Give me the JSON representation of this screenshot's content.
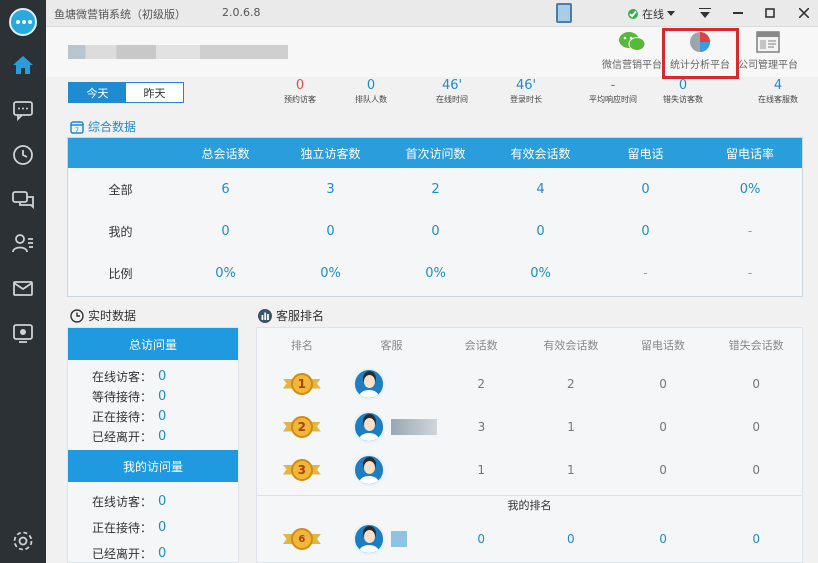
{
  "app": {
    "title": "鱼塘微营销系统（初级版）",
    "version": "2.0.6.8",
    "status": "在线"
  },
  "tools": [
    {
      "label": "微信营销平台",
      "icon": "wechat-icon"
    },
    {
      "label": "统计分析平台",
      "icon": "pie-chart-icon"
    },
    {
      "label": "公司管理平台",
      "icon": "window-icon"
    }
  ],
  "tabs": [
    "今天",
    "昨天"
  ],
  "stats": [
    {
      "value": "0",
      "label": "预约访客",
      "color": "#e05050"
    },
    {
      "value": "0",
      "label": "排队人数",
      "color": "#1f8bd1"
    },
    {
      "value": "46'",
      "label": "在线时间",
      "color": "#1f8bd1"
    },
    {
      "value": "46'",
      "label": "登录时长",
      "color": "#1f8bd1"
    },
    {
      "value": "-",
      "label": "平均响应时间",
      "color": "#1f8bd1"
    },
    {
      "value": "0",
      "label": "错失访客数",
      "color": "#1f8bd1"
    },
    {
      "value": "4",
      "label": "在线客服数",
      "color": "#1f8bd1"
    }
  ],
  "combined": {
    "title": "综合数据",
    "headers": [
      "",
      "总会话数",
      "独立访客数",
      "首次访问数",
      "有效会话数",
      "留电话",
      "留电话率"
    ],
    "rows": [
      {
        "label": "全部",
        "values": [
          "6",
          "3",
          "2",
          "4",
          "0",
          "0%"
        ]
      },
      {
        "label": "我的",
        "values": [
          "0",
          "0",
          "0",
          "0",
          "0",
          "-"
        ]
      },
      {
        "label": "比例",
        "values": [
          "0%",
          "0%",
          "0%",
          "0%",
          "-",
          "-"
        ]
      }
    ]
  },
  "realtime": {
    "title": "实时数据",
    "total_title": "总访问量",
    "total_lines": [
      {
        "label": "在线访客：",
        "value": "0"
      },
      {
        "label": "等待接待：",
        "value": "0"
      },
      {
        "label": "正在接待：",
        "value": "0"
      },
      {
        "label": "已经离开：",
        "value": "0"
      }
    ],
    "mine_title": "我的访问量",
    "mine_lines": [
      {
        "label": "在线访客：",
        "value": "0"
      },
      {
        "label": "正在接待：",
        "value": "0"
      },
      {
        "label": "已经离开：",
        "value": "0"
      }
    ]
  },
  "ranking": {
    "title": "客服排名",
    "headers": [
      "排名",
      "客服",
      "会话数",
      "有效会话数",
      "留电话数",
      "错失会话数"
    ],
    "rows": [
      {
        "rank": "1",
        "sessions": "2",
        "valid": "2",
        "phones": "0",
        "missed": "0"
      },
      {
        "rank": "2",
        "sessions": "3",
        "valid": "1",
        "phones": "0",
        "missed": "0"
      },
      {
        "rank": "3",
        "sessions": "1",
        "valid": "1",
        "phones": "0",
        "missed": "0"
      }
    ],
    "my_rank_label": "我的排名",
    "my_row": {
      "rank": "6",
      "sessions": "0",
      "valid": "0",
      "phones": "0",
      "missed": "0"
    }
  }
}
